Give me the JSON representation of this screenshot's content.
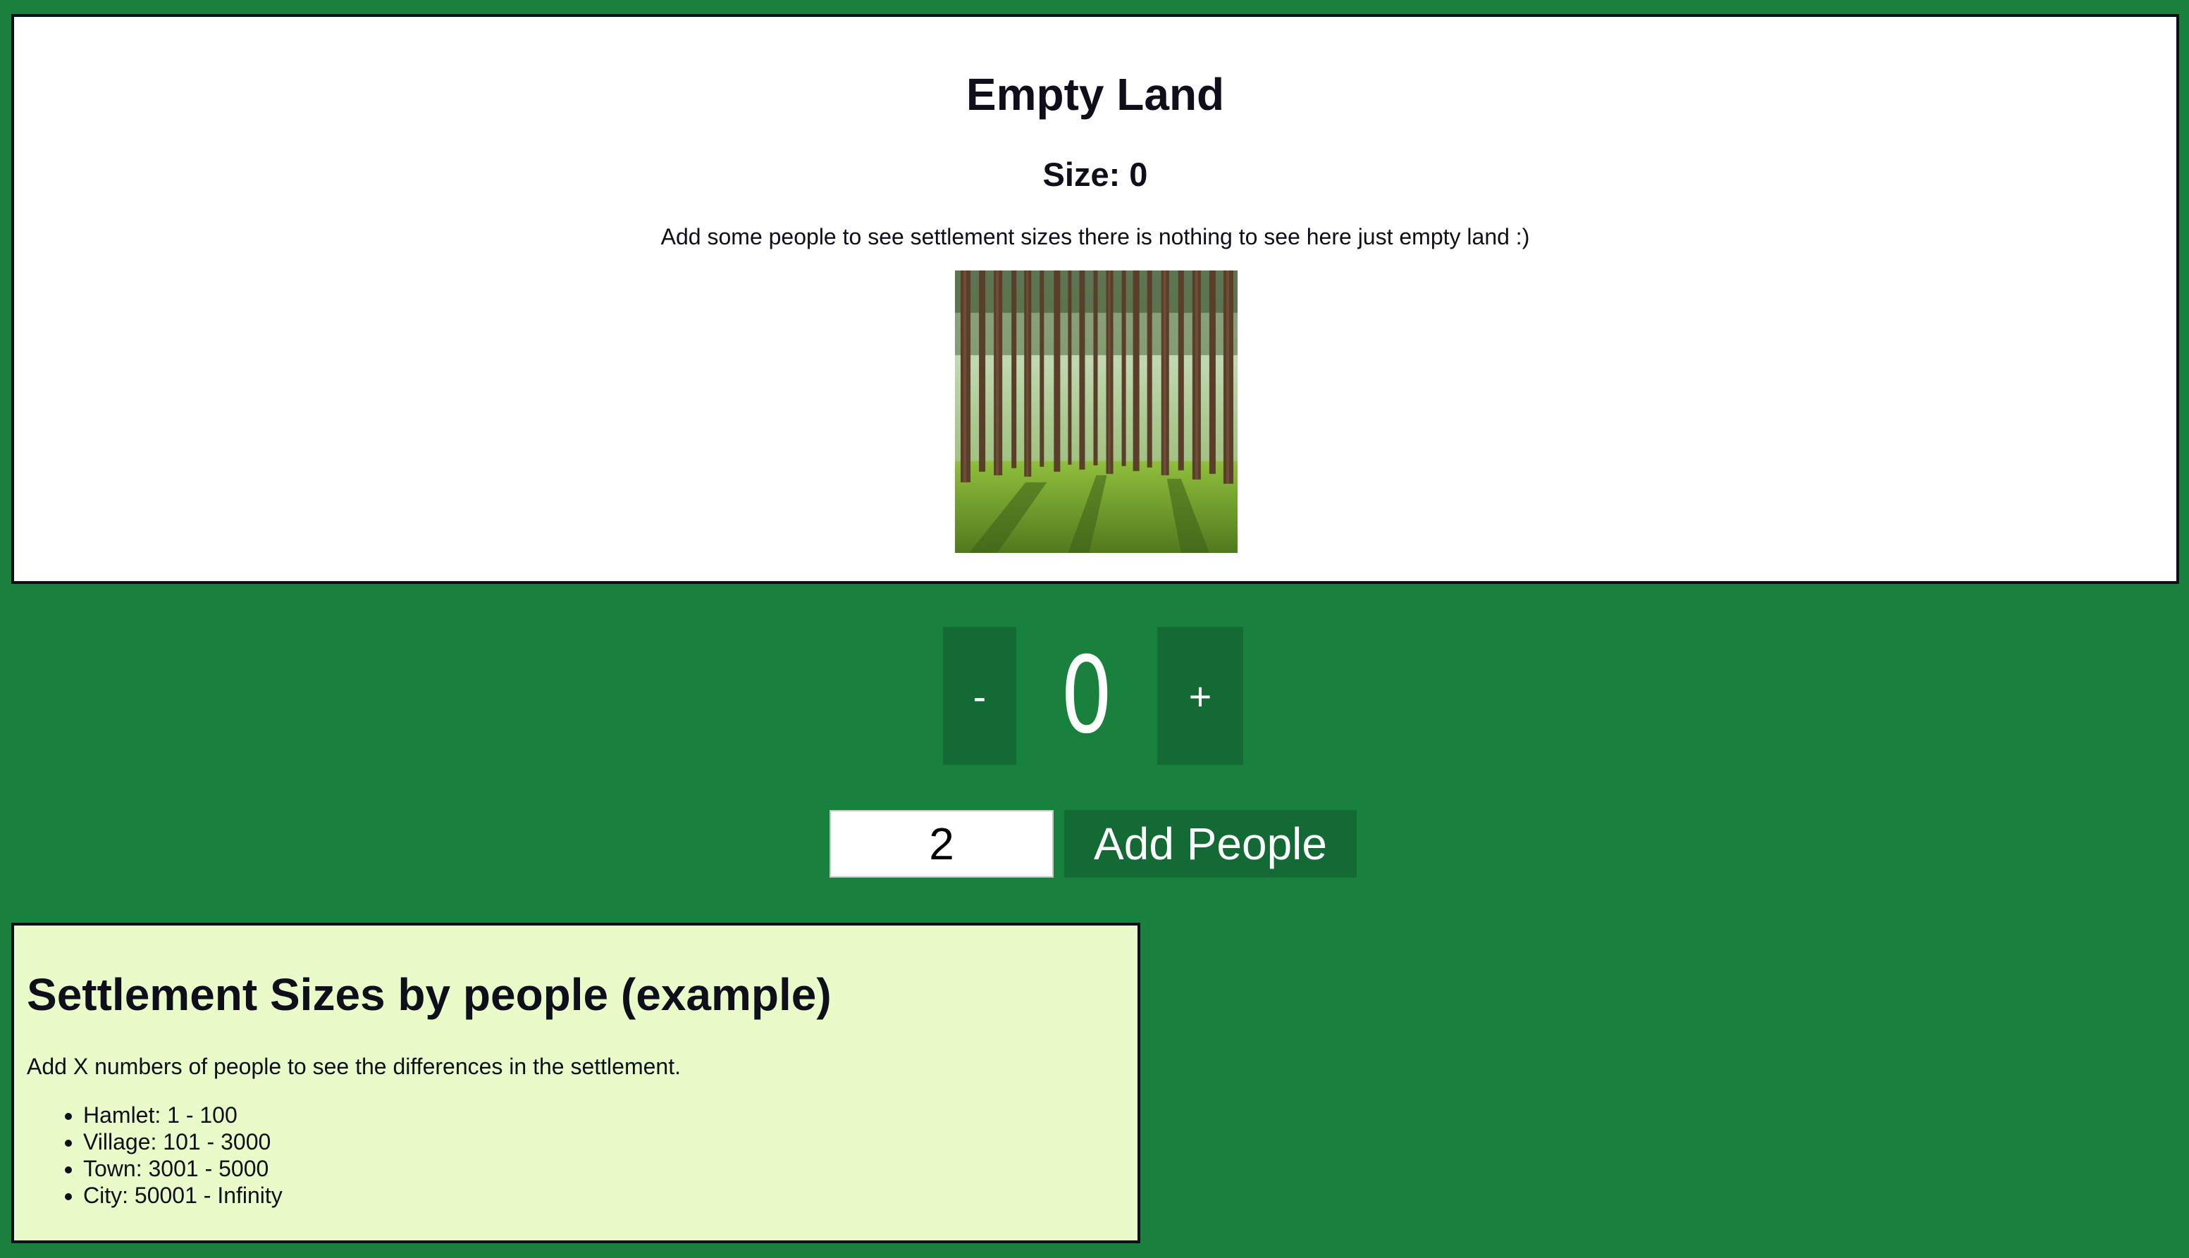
{
  "settlement": {
    "title": "Empty Land",
    "size_label": "Size: 0",
    "description": "Add some people to see settlement sizes there is nothing to see here just empty land :)",
    "image_alt": "forest"
  },
  "counter": {
    "minus_label": "-",
    "value": "0",
    "plus_label": "+"
  },
  "add_people": {
    "input_value": "2",
    "button_label": "Add People"
  },
  "info": {
    "title": "Settlement Sizes by people (example)",
    "description": "Add X numbers of people to see the differences in the settlement.",
    "items": [
      "Hamlet: 1 - 100",
      "Village: 101 - 3000",
      "Town: 3001 - 5000",
      "City: 50001 - Infinity"
    ]
  },
  "colors": {
    "page_background": "#17813d",
    "button_background": "#146a35",
    "card_background": "#ffffff",
    "info_background": "#eafbca",
    "border": "#0e0f1a"
  }
}
